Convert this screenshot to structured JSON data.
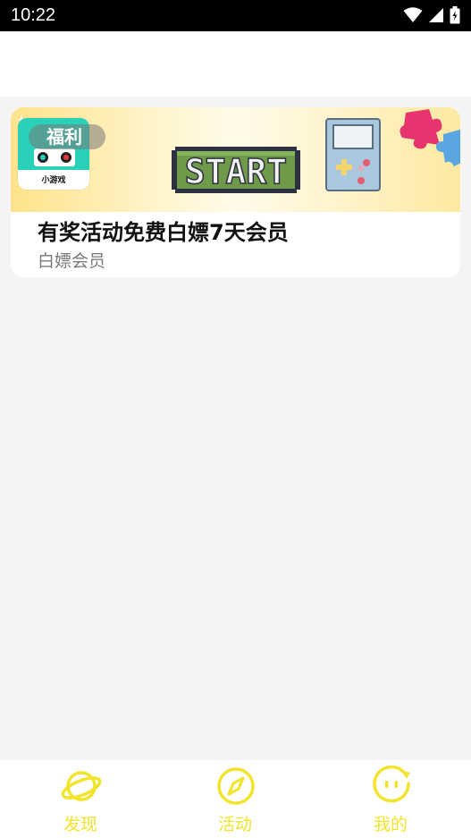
{
  "status_bar": {
    "time": "10:22",
    "icons": [
      "wifi-icon",
      "signal-icon",
      "battery-icon"
    ]
  },
  "card": {
    "badge": "福利",
    "app_tile_label": "小游戏",
    "start_text": "START",
    "title": "有奖活动免费白嫖7天会员",
    "subtitle": "白嫖会员"
  },
  "tabs": [
    {
      "label": "发现",
      "icon": "planet-icon"
    },
    {
      "label": "活动",
      "icon": "compass-icon"
    },
    {
      "label": "我的",
      "icon": "smiley-face-icon"
    }
  ],
  "colors": {
    "accent": "#f2e32c",
    "background": "#f4f4f5",
    "status_bar": "#000000",
    "teal": "#2ad1b8",
    "start_green": "#6f9a4a"
  }
}
